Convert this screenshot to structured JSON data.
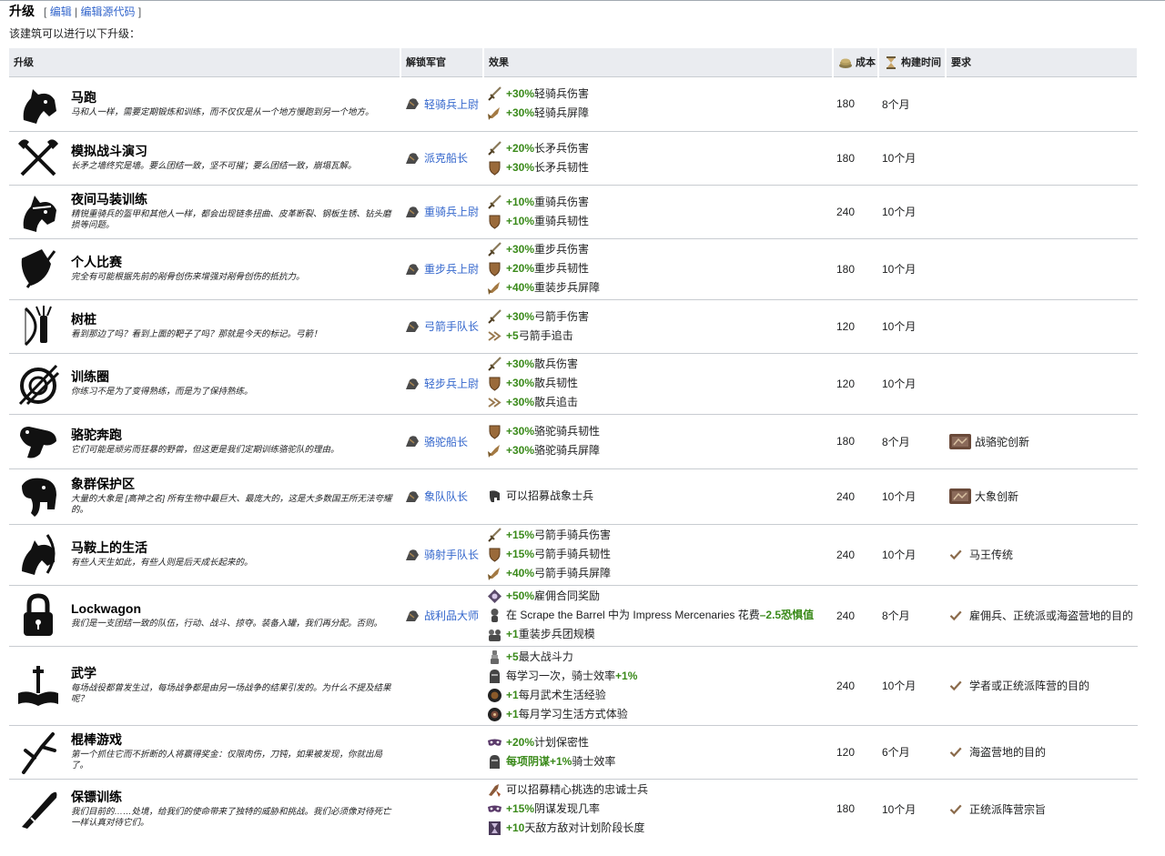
{
  "section": {
    "title": "升级",
    "edit_open": "[",
    "edit_label": "编辑",
    "edit_sep": " | ",
    "edit_source_label": "编辑源代码",
    "edit_close": "]"
  },
  "intro": "该建筑可以进行以下升级：",
  "headers": {
    "upgrade": "升级",
    "unlock": "解锁军官",
    "effect": "效果",
    "cost": "成本",
    "time": "构建时间",
    "req": "要求"
  },
  "rows": [
    {
      "name": "马跑",
      "desc": "马和人一样，需要定期锻炼和训练，而不仅仅是从一个地方慢跑到另一个地方。",
      "icon": "horse-head-icon",
      "unlock": "轻骑兵上尉",
      "effects": [
        {
          "icon": "sword-icon",
          "value": "+30%",
          "text": "轻骑兵伤害"
        },
        {
          "icon": "charge-icon",
          "value": "+30%",
          "text": "轻骑兵屏障"
        }
      ],
      "cost": "180",
      "time": "8个月",
      "req": ""
    },
    {
      "name": "模拟战斗演习",
      "desc": "长矛之墙终究是墙。要么团结一致，坚不可摧；要么团结一致，崩塌瓦解。",
      "icon": "crossed-axes-icon",
      "unlock": "派克船长",
      "effects": [
        {
          "icon": "sword-icon",
          "value": "+20%",
          "text": "长矛兵伤害"
        },
        {
          "icon": "shield-icon",
          "value": "+30%",
          "text": "长矛兵韧性"
        }
      ],
      "cost": "180",
      "time": "10个月",
      "req": ""
    },
    {
      "name": "夜间马装训练",
      "desc": "精锐重骑兵的盔甲和其他人一样，都会出现链条扭曲、皮革断裂、钢板生锈、钻头磨损等问题。",
      "icon": "armored-horse-icon",
      "unlock": "重骑兵上尉",
      "effects": [
        {
          "icon": "sword-icon",
          "value": "+10%",
          "text": "重骑兵伤害"
        },
        {
          "icon": "shield-icon",
          "value": "+10%",
          "text": "重骑兵韧性"
        }
      ],
      "cost": "240",
      "time": "10个月",
      "req": ""
    },
    {
      "name": "个人比赛",
      "desc": "完全有可能根据先前的剐骨创伤来增强对剐骨创伤的抵抗力。",
      "icon": "shield-sword-icon",
      "unlock": "重步兵上尉",
      "effects": [
        {
          "icon": "sword-icon",
          "value": "+30%",
          "text": "重步兵伤害"
        },
        {
          "icon": "shield-icon",
          "value": "+20%",
          "text": "重步兵韧性"
        },
        {
          "icon": "charge-icon",
          "value": "+40%",
          "text": "重装步兵屏障"
        }
      ],
      "cost": "180",
      "time": "10个月",
      "req": ""
    },
    {
      "name": "树桩",
      "desc": "看到那边了吗？看到上面的靶子了吗？那就是今天的标记。弓箭！",
      "icon": "bow-quiver-icon",
      "unlock": "弓箭手队长",
      "effects": [
        {
          "icon": "sword-icon",
          "value": "+30%",
          "text": "弓箭手伤害"
        },
        {
          "icon": "pursuit-icon",
          "value": "+5",
          "text": "弓箭手追击"
        }
      ],
      "cost": "120",
      "time": "10个月",
      "req": ""
    },
    {
      "name": "训练圈",
      "desc": "你练习不是为了变得熟练，而是为了保持熟练。",
      "icon": "target-spears-icon",
      "unlock": "轻步兵上尉",
      "effects": [
        {
          "icon": "sword-icon",
          "value": "+30%",
          "text": "散兵伤害"
        },
        {
          "icon": "shield-icon",
          "value": "+30%",
          "text": "散兵韧性"
        },
        {
          "icon": "pursuit-icon",
          "value": "+30%",
          "text": "散兵追击"
        }
      ],
      "cost": "120",
      "time": "10个月",
      "req": ""
    },
    {
      "name": "骆驼奔跑",
      "desc": "它们可能是顽劣而狂暴的野兽，但这更是我们定期训练骆驼队的理由。",
      "icon": "camel-icon",
      "unlock": "骆驼船长",
      "effects": [
        {
          "icon": "shield-icon",
          "value": "+30%",
          "text": "骆驼骑兵韧性"
        },
        {
          "icon": "charge-icon",
          "value": "+30%",
          "text": "骆驼骑兵屏障"
        }
      ],
      "cost": "180",
      "time": "8个月",
      "req_icon": "innovation-icon",
      "req": "战骆驼创新"
    },
    {
      "name": "象群保护区",
      "desc": "大量的大象是 [高神之名] 所有生物中最巨大、最庞大的，这是大多数国王所无法夸耀的。",
      "icon": "elephant-icon",
      "unlock": "象队队长",
      "effects": [
        {
          "icon": "elephant-small-icon",
          "value": "",
          "text": "可以招募战象士兵"
        }
      ],
      "cost": "240",
      "time": "10个月",
      "req_icon": "innovation-icon",
      "req": "大象创新"
    },
    {
      "name": "马鞍上的生活",
      "desc": "有些人天生如此，有些人则是后天成长起来的。",
      "icon": "horse-archer-icon",
      "unlock": "骑射手队长",
      "effects": [
        {
          "icon": "sword-icon",
          "value": "+15%",
          "text": "弓箭手骑兵伤害"
        },
        {
          "icon": "shield-icon",
          "value": "+15%",
          "text": "弓箭手骑兵韧性"
        },
        {
          "icon": "charge-icon",
          "value": "+40%",
          "text": "弓箭手骑兵屏障"
        }
      ],
      "cost": "240",
      "time": "10个月",
      "req_icon": "check-icon",
      "req": "马王传统"
    },
    {
      "name": "Lockwagon",
      "desc": "我们是一支团结一致的队伍，行动、战斗、掠夺。装备入罐，我们再分配。否则。",
      "icon": "padlock-icon",
      "unlock": "战利品大师",
      "effects": [
        {
          "icon": "contract-icon",
          "value": "+50%",
          "text": "雇佣合同奖励"
        },
        {
          "icon": "scheme-icon",
          "value": "",
          "text": "在 Scrape the Barrel 中为 Impress Mercenaries 花费",
          "value2": "–2.5恐惧值"
        },
        {
          "icon": "men-icon",
          "value": "+1",
          "text": "重装步兵团规模"
        }
      ],
      "cost": "240",
      "time": "8个月",
      "req_icon": "check-icon",
      "req": "雇佣兵、正统派或海盗营地的目的"
    },
    {
      "name": "武学",
      "desc": "每场战役都曾发生过，每场战争都是由另一场战争的结果引发的。为什么不提及结果呢？",
      "icon": "book-sword-icon",
      "unlock": "",
      "effects": [
        {
          "icon": "prowess-icon",
          "value": "+5",
          "text": "最大战斗力"
        },
        {
          "icon": "knight-icon",
          "value": "",
          "text": "每学习一次，骑士效率",
          "value2": "+1%"
        },
        {
          "icon": "lifestyle-icon",
          "value": "+1",
          "text": "每月武术生活经验"
        },
        {
          "icon": "lifestyle2-icon",
          "value": "+1",
          "text": "每月学习生活方式体验"
        }
      ],
      "cost": "240",
      "time": "10个月",
      "req_icon": "check-icon",
      "req": "学者或正统派阵营的目的"
    },
    {
      "name": "棍棒游戏",
      "desc": "第一个抓住它而不折断的人将赢得奖金：仅限肉伤，刀钝，如果被发现，你就出局了。",
      "icon": "stick-icon",
      "unlock": "",
      "effects": [
        {
          "icon": "mask-icon",
          "value": "+20%",
          "text": "计划保密性"
        },
        {
          "icon": "knight-icon",
          "value": "每项阴谋+1%",
          "text": "骑士效率"
        }
      ],
      "cost": "120",
      "time": "6个月",
      "req_icon": "check-icon",
      "req": "海盗营地的目的"
    },
    {
      "name": "保镖训练",
      "desc": "我们目前的……处境，给我们的使命带来了独特的威胁和挑战。我们必须像对待死亡一样认真对待它们。",
      "icon": "club-icon",
      "unlock": "",
      "effects": [
        {
          "icon": "guard-icon",
          "value": "",
          "text": "可以招募精心挑选的忠诚士兵"
        },
        {
          "icon": "mask-icon",
          "value": "+15%",
          "text": "阴谋发现几率"
        },
        {
          "icon": "hourglass-icon",
          "value": "+10",
          "text": "天敌方敌对计划阶段长度"
        }
      ],
      "cost": "180",
      "time": "10个月",
      "req_icon": "check-icon",
      "req": "正统派阵营宗旨"
    }
  ],
  "colors": {
    "positive": "#3a8a1a",
    "link": "#3366cc",
    "header_bg": "#eaecf0"
  }
}
